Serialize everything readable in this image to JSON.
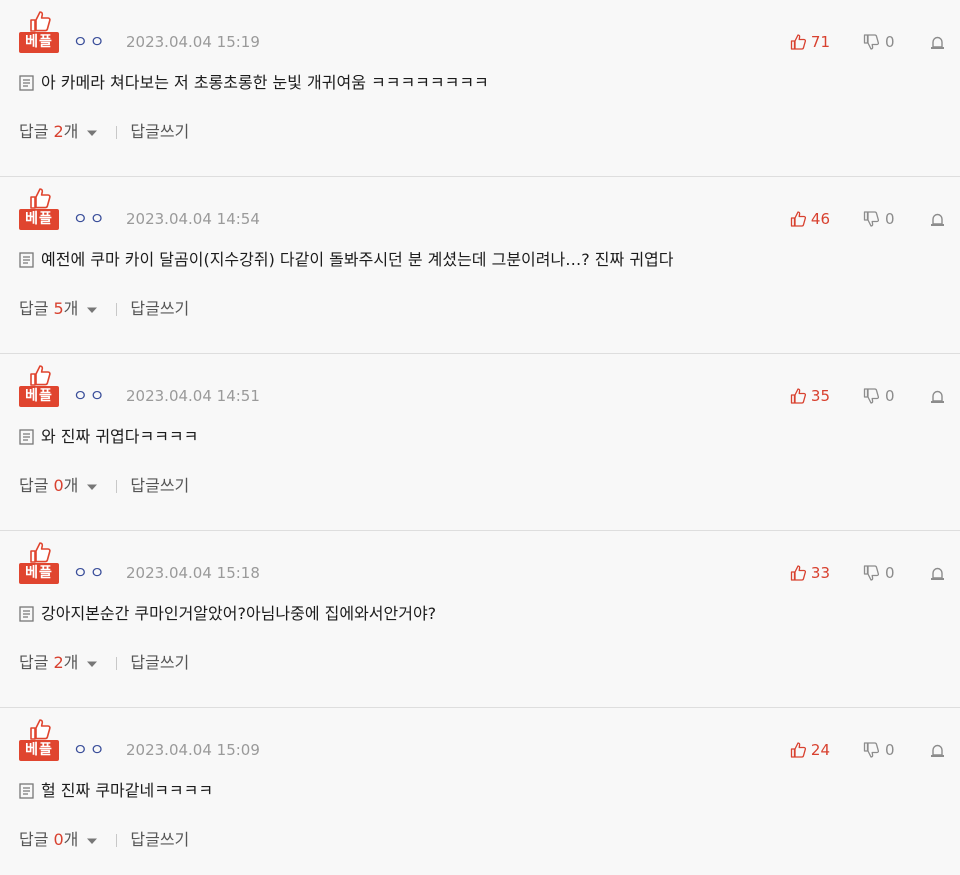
{
  "best_label": "베플",
  "author_mask": "ㅇㅇ",
  "reply_label": "답글",
  "reply_unit": "개",
  "write_reply_label": "답글쓰기",
  "colors": {
    "accent": "#e0452f",
    "like": "#d8412f",
    "muted": "#9a9a9a",
    "author": "#3a4e9a"
  },
  "comments": [
    {
      "date": "2023.04.04 15:19",
      "likes": "71",
      "dislikes": "0",
      "text": "아 카메라 쳐다보는 저 초롱초롱한 눈빛 개귀여움 ㅋㅋㅋㅋㅋㅋㅋㅋ",
      "reply_count": "2"
    },
    {
      "date": "2023.04.04 14:54",
      "likes": "46",
      "dislikes": "0",
      "text": "예전에 쿠마 카이 달곰이(지수강쥐) 다같이 돌봐주시던 분 계셨는데 그분이려나…? 진짜 귀엽다",
      "reply_count": "5"
    },
    {
      "date": "2023.04.04 14:51",
      "likes": "35",
      "dislikes": "0",
      "text": "와 진짜 귀엽다ㅋㅋㅋㅋ",
      "reply_count": "0"
    },
    {
      "date": "2023.04.04 15:18",
      "likes": "33",
      "dislikes": "0",
      "text": "강아지본순간 쿠마인거알았어?아님나중에 집에와서안거야?",
      "reply_count": "2"
    },
    {
      "date": "2023.04.04 15:09",
      "likes": "24",
      "dislikes": "0",
      "text": "헐 진짜 쿠마같네ㅋㅋㅋㅋ",
      "reply_count": "0"
    }
  ]
}
